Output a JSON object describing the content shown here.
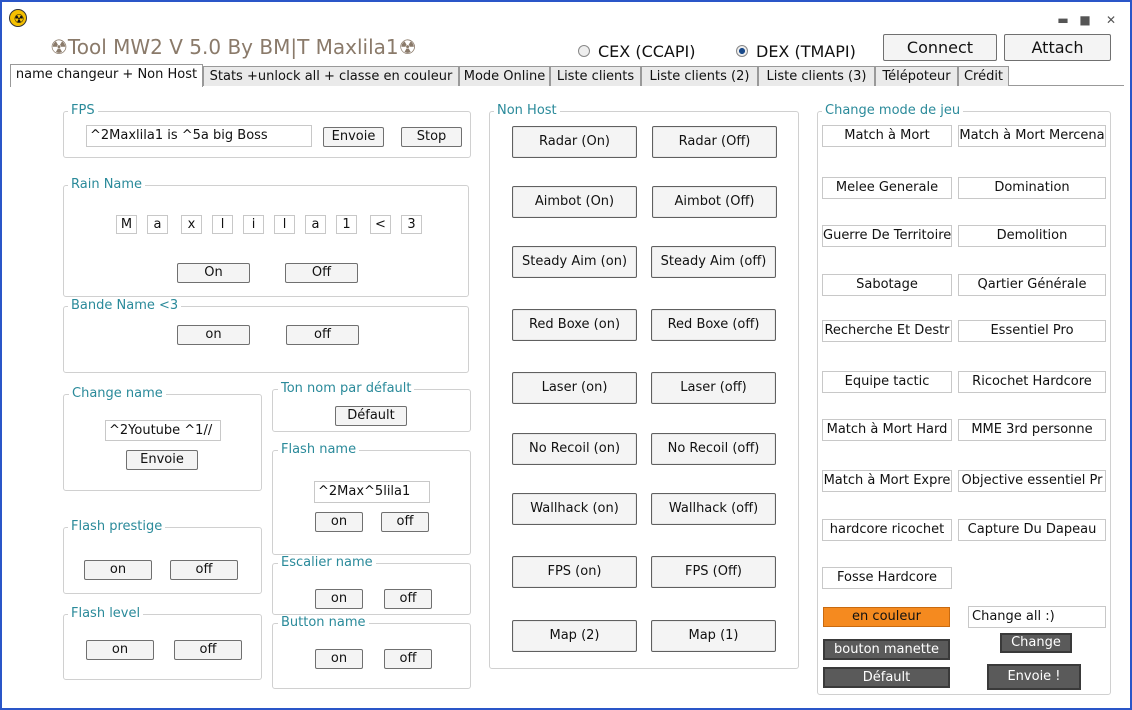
{
  "window": {
    "title": "☢Tool MW2 V 5.0  By BM|T Maxlila1☢",
    "minimize_glyph": "▬",
    "maximize_glyph": "■",
    "close_glyph": "✕",
    "app_icon_glyph": "☢"
  },
  "connection": {
    "radio_cex": "CEX (CCAPI)",
    "radio_dex": "DEX (TMAPI)",
    "connect_label": "Connect",
    "attach_label": "Attach"
  },
  "tabs": [
    {
      "label": "name changeur + Non Host"
    },
    {
      "label": "Stats +unlock all + classe en couleur"
    },
    {
      "label": "Mode Online"
    },
    {
      "label": "Liste clients"
    },
    {
      "label": "Liste clients (2)"
    },
    {
      "label": "Liste clients (3)"
    },
    {
      "label": "Télépoteur"
    },
    {
      "label": "Crédit"
    }
  ],
  "fps": {
    "label": "FPS",
    "input_value": "^2Maxlila1 is ^5a big Boss",
    "send_label": "Envoie",
    "stop_label": "Stop"
  },
  "rain_name": {
    "label": "Rain Name",
    "letters": [
      "M",
      "a",
      "x",
      "l",
      "i",
      "l",
      "a",
      "1",
      "<",
      "3"
    ],
    "on_label": "On",
    "off_label": "Off"
  },
  "bande_name": {
    "label": "Bande Name <3",
    "on_label": "on",
    "off_label": "off"
  },
  "change_name": {
    "label": "Change name",
    "input_value": "^2Youtube ^1//",
    "send_label": "Envoie"
  },
  "default_name": {
    "label": "Ton nom par défault",
    "button_label": "Défault"
  },
  "flash_name": {
    "label": "Flash name",
    "input_value": "^2Max^5lila1",
    "on_label": "on",
    "off_label": "off"
  },
  "flash_prestige": {
    "label": "Flash prestige",
    "on_label": "on",
    "off_label": "off"
  },
  "escalier_name": {
    "label": "Escalier name",
    "on_label": "on",
    "off_label": "off"
  },
  "flash_level": {
    "label": "Flash level",
    "on_label": "on",
    "off_label": "off"
  },
  "button_name": {
    "label": "Button name",
    "on_label": "on",
    "off_label": "off"
  },
  "non_host": {
    "label": "Non Host",
    "rows": [
      [
        "Radar (On)",
        "Radar (Off)"
      ],
      [
        "Aimbot (On)",
        "Aimbot (Off)"
      ],
      [
        "Steady Aim (on)",
        "Steady Aim (off)"
      ],
      [
        "Red Boxe (on)",
        "Red Boxe (off)"
      ],
      [
        "Laser (on)",
        "Laser (off)"
      ],
      [
        "No Recoil (on)",
        "No Recoil (off)"
      ],
      [
        "Wallhack (on)",
        "Wallhack (off)"
      ],
      [
        "FPS (on)",
        "FPS (Off)"
      ],
      [
        "Map (2)",
        "Map (1)"
      ]
    ]
  },
  "game_mode": {
    "label": "Change mode de jeu",
    "rows": [
      [
        "Match à Mort",
        "Match à Mort Mercena"
      ],
      [
        "Melee Generale",
        "Domination"
      ],
      [
        "Guerre De Territoire",
        "Demolition"
      ],
      [
        "Sabotage",
        "Qartier Générale"
      ],
      [
        "Recherche Et Destr",
        "Essentiel Pro"
      ],
      [
        "Equipe tactic",
        "Ricochet Hardcore"
      ],
      [
        "Match à Mort Hard",
        "MME 3rd personne"
      ],
      [
        "Match à Mort Expre",
        "Objective essentiel Pr"
      ],
      [
        "hardcore ricochet",
        "Capture Du Dapeau"
      ],
      [
        "Fosse Hardcore",
        ""
      ]
    ],
    "color_label": "en couleur",
    "change_all_value": "Change all :)",
    "controller_label": "bouton manette",
    "change_label": "Change",
    "default_label": "Défault",
    "send_label": "Envoie !"
  },
  "colors": {
    "accent_label": "#2a8a9a",
    "orange": "#f58a1f",
    "dark_button": "#5a5a5a"
  }
}
